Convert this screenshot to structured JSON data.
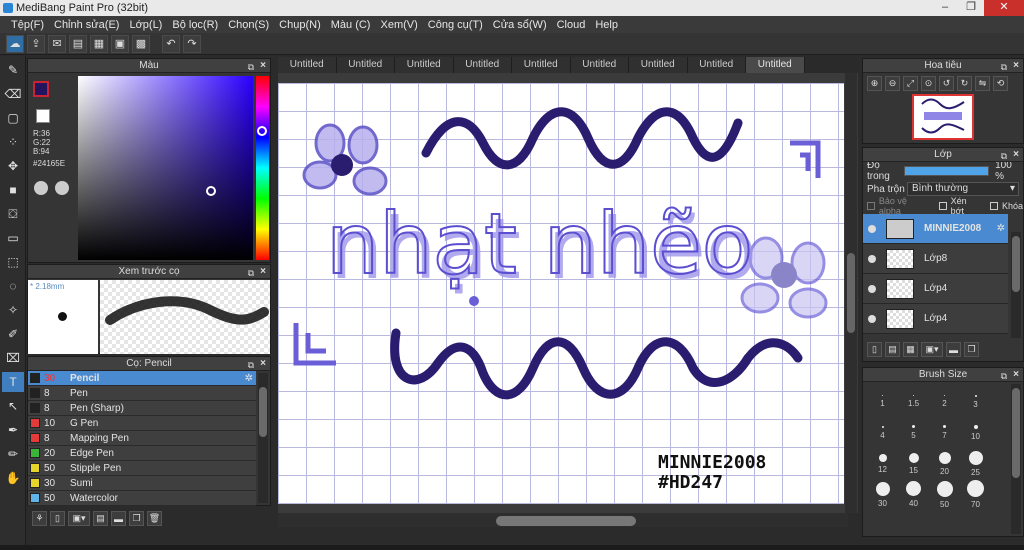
{
  "app_title": "MediBang Paint Pro (32bit)",
  "window_controls": {
    "minimize": "‒",
    "restore": "❐",
    "close": "✕"
  },
  "menu": [
    "Tệp(F)",
    "Chỉnh sửa(E)",
    "Lớp(L)",
    "Bộ lọc(R)",
    "Chọn(S)",
    "Chụp(N)",
    "Màu (C)",
    "Xem(V)",
    "Công cụ(T)",
    "Cửa sổ(W)",
    "Cloud",
    "Help"
  ],
  "color_panel": {
    "title": "Màu",
    "primary_color": "#24165E",
    "r": "R:36",
    "g": "G:22",
    "b": "B:94",
    "hex": "#24165E"
  },
  "brush_preview": {
    "title": "Xem trước cọ",
    "size": "2.18mm"
  },
  "brush_panel": {
    "title": "Cọ: Pencil",
    "items": [
      {
        "size": "30",
        "name": "Pencil",
        "color": "#222222",
        "selected": true
      },
      {
        "size": "8",
        "name": "Pen",
        "color": "#222222"
      },
      {
        "size": "8",
        "name": "Pen (Sharp)",
        "color": "#222222"
      },
      {
        "size": "10",
        "name": "G Pen",
        "color": "#e33b3b"
      },
      {
        "size": "8",
        "name": "Mapping Pen",
        "color": "#e33b3b"
      },
      {
        "size": "20",
        "name": "Edge Pen",
        "color": "#3ab53a"
      },
      {
        "size": "50",
        "name": "Stipple Pen",
        "color": "#e5d52a"
      },
      {
        "size": "30",
        "name": "Sumi",
        "color": "#e5d52a"
      },
      {
        "size": "50",
        "name": "Watercolor",
        "color": "#5fb4e8"
      }
    ]
  },
  "tabs": [
    "Untitled",
    "Untitled",
    "Untitled",
    "Untitled",
    "Untitled",
    "Untitled",
    "Untitled",
    "Untitled",
    "Untitled"
  ],
  "artwork": {
    "title_text": "nhạt nhẽo",
    "signature_line1": "MINNIE2008",
    "signature_line2": "#HD247",
    "ink_color": "#2a1c6e",
    "light_color": "#6a5fd6"
  },
  "navigator": {
    "title": "Hoa tiêu"
  },
  "layer_panel": {
    "title": "Lớp",
    "opacity_label": "Độ trong",
    "opacity_value": "100 %",
    "opacity": 1.0,
    "blend_label": "Pha trộn",
    "blend_value": "Bình thường",
    "protect_alpha": "Bảo vệ alpha",
    "clipping": "Xén bớt",
    "lock": "Khóa",
    "layers": [
      {
        "name": "MINNIE2008",
        "selected": true
      },
      {
        "name": "Lớp8"
      },
      {
        "name": "Lớp4"
      },
      {
        "name": "Lớp4"
      }
    ]
  },
  "brush_size_panel": {
    "title": "Brush Size",
    "sizes": [
      "1",
      "1.5",
      "2",
      "3",
      "4",
      "5",
      "7",
      "10",
      "12",
      "15",
      "20",
      "25",
      "30",
      "40",
      "50",
      "70"
    ]
  }
}
